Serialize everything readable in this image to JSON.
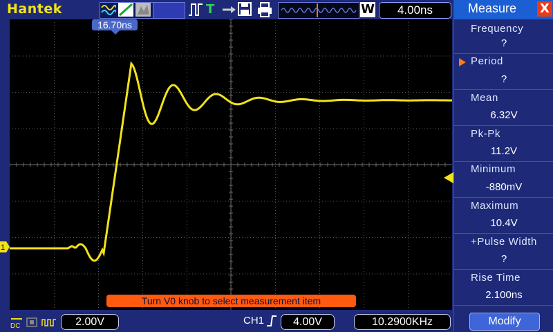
{
  "header": {
    "brand": "Hantek",
    "timebase": "4.00ns",
    "w_badge": "W",
    "trigger_position": "16.70ns"
  },
  "icons": [
    "wave-icon",
    "slope-icon",
    "stop-icon",
    "pulse-icon",
    "trigger-t-icon",
    "save-icon",
    "printer-icon"
  ],
  "screen": {
    "hint": "Turn V0 knob to select measurement item",
    "channel_marker": "1"
  },
  "bottom": {
    "volts_per_div": "2.00V",
    "trigger_channel": "CH1",
    "trigger_level": "4.00V",
    "frequency": "10.2900KHz"
  },
  "measure_panel": {
    "title": "Measure",
    "close": "X",
    "items": [
      {
        "label": "Frequency",
        "value": "?"
      },
      {
        "label": "Period",
        "value": "?"
      },
      {
        "label": "Mean",
        "value": "6.32V"
      },
      {
        "label": "Pk-Pk",
        "value": "11.2V"
      },
      {
        "label": "Minimum",
        "value": "-880mV"
      },
      {
        "label": "Maximum",
        "value": "10.4V"
      },
      {
        "label": "+Pulse Width",
        "value": "?"
      },
      {
        "label": "Rise Time",
        "value": "2.100ns"
      }
    ],
    "selected_index": 1,
    "modify_label": "Modify"
  },
  "colors": {
    "background": "#1e2a78",
    "trace": "#f2e21a",
    "hint": "#ff5a0f",
    "accent": "#ff7a14"
  }
}
